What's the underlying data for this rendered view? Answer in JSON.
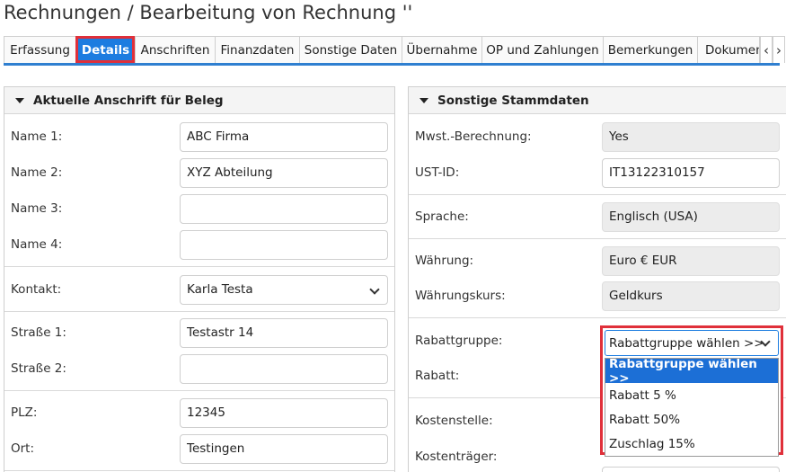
{
  "page": {
    "title": "Rechnungen / Bearbeitung von Rechnung ''"
  },
  "tabs": [
    {
      "label": "Erfassung"
    },
    {
      "label": "Details"
    },
    {
      "label": "Anschriften"
    },
    {
      "label": "Finanzdaten"
    },
    {
      "label": "Sonstige Daten"
    },
    {
      "label": "Übernahme"
    },
    {
      "label": "OP und Zahlungen"
    },
    {
      "label": "Bemerkungen"
    },
    {
      "label": "Dokumente"
    }
  ],
  "tab_nav": {
    "prev": "‹",
    "next": "›"
  },
  "left_panel": {
    "title": "Aktuelle Anschrift für Beleg",
    "name1_label": "Name 1:",
    "name1_value": "ABC Firma",
    "name2_label": "Name 2:",
    "name2_value": "XYZ Abteilung",
    "name3_label": "Name 3:",
    "name3_value": "",
    "name4_label": "Name 4:",
    "name4_value": "",
    "kontakt_label": "Kontakt:",
    "kontakt_value": "Karla Testa",
    "strasse1_label": "Straße 1:",
    "strasse1_value": "Testastr 14",
    "strasse2_label": "Straße 2:",
    "strasse2_value": "",
    "plz_label": "PLZ:",
    "plz_value": "12345",
    "ort_label": "Ort:",
    "ort_value": "Testingen"
  },
  "right_panel": {
    "title": "Sonstige Stammdaten",
    "mwst_label": "Mwst.-Berechnung:",
    "mwst_value": "Yes",
    "ustid_label": "UST-ID:",
    "ustid_value": "IT13122310157",
    "sprache_label": "Sprache:",
    "sprache_value": "Englisch (USA)",
    "waehrung_label": "Währung:",
    "waehrung_value": "Euro € EUR",
    "kurs_label": "Währungskurs:",
    "kurs_value": "Geldkurs",
    "rabattgruppe_label": "Rabattgruppe:",
    "rabatt_label": "Rabatt:",
    "kostenstelle_label": "Kostenstelle:",
    "kostentraeger_label": "Kostenträger:"
  },
  "rabatt_dropdown": {
    "selected": "Rabattgruppe wählen >>",
    "options": [
      "Rabattgruppe wählen >>",
      "Rabatt 5 %",
      "Rabatt 50%",
      "Zuschlag 15%"
    ]
  },
  "colors": {
    "accent": "#1c7ce0",
    "highlight": "#e0303a"
  }
}
